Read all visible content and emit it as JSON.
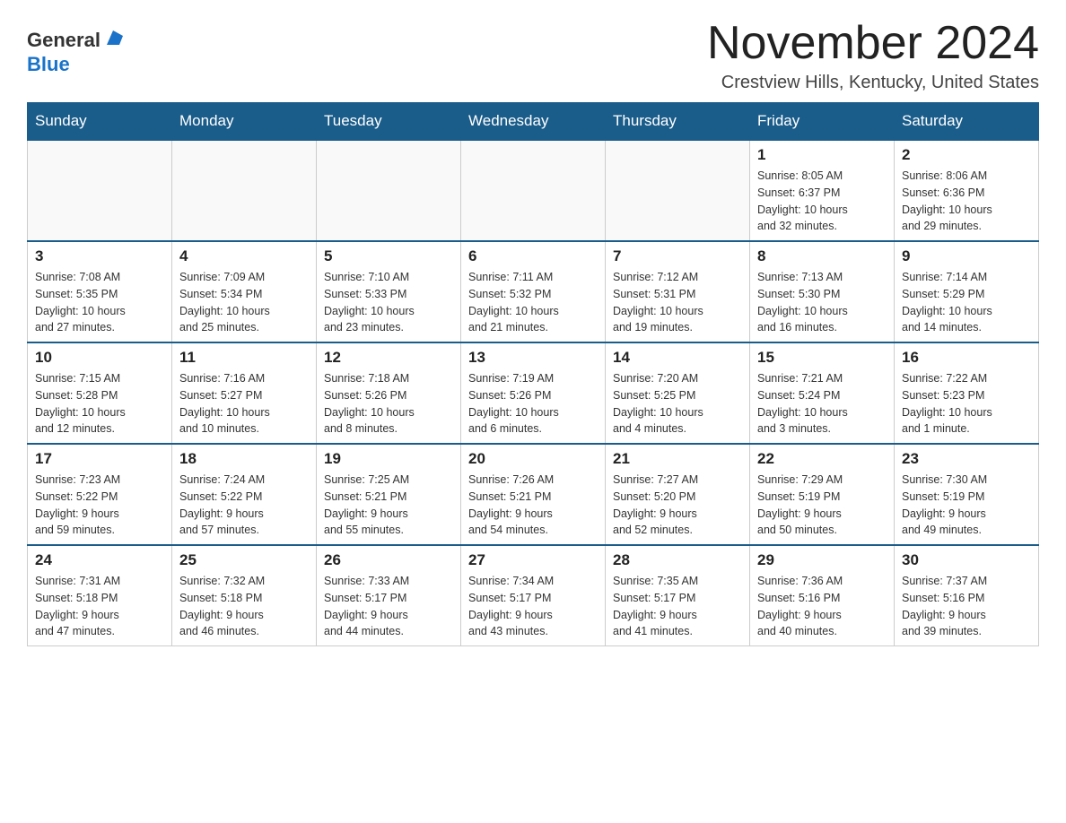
{
  "header": {
    "logo_general": "General",
    "logo_blue": "Blue",
    "month": "November 2024",
    "location": "Crestview Hills, Kentucky, United States"
  },
  "days_of_week": [
    "Sunday",
    "Monday",
    "Tuesday",
    "Wednesday",
    "Thursday",
    "Friday",
    "Saturday"
  ],
  "weeks": [
    [
      {
        "day": "",
        "info": ""
      },
      {
        "day": "",
        "info": ""
      },
      {
        "day": "",
        "info": ""
      },
      {
        "day": "",
        "info": ""
      },
      {
        "day": "",
        "info": ""
      },
      {
        "day": "1",
        "info": "Sunrise: 8:05 AM\nSunset: 6:37 PM\nDaylight: 10 hours\nand 32 minutes."
      },
      {
        "day": "2",
        "info": "Sunrise: 8:06 AM\nSunset: 6:36 PM\nDaylight: 10 hours\nand 29 minutes."
      }
    ],
    [
      {
        "day": "3",
        "info": "Sunrise: 7:08 AM\nSunset: 5:35 PM\nDaylight: 10 hours\nand 27 minutes."
      },
      {
        "day": "4",
        "info": "Sunrise: 7:09 AM\nSunset: 5:34 PM\nDaylight: 10 hours\nand 25 minutes."
      },
      {
        "day": "5",
        "info": "Sunrise: 7:10 AM\nSunset: 5:33 PM\nDaylight: 10 hours\nand 23 minutes."
      },
      {
        "day": "6",
        "info": "Sunrise: 7:11 AM\nSunset: 5:32 PM\nDaylight: 10 hours\nand 21 minutes."
      },
      {
        "day": "7",
        "info": "Sunrise: 7:12 AM\nSunset: 5:31 PM\nDaylight: 10 hours\nand 19 minutes."
      },
      {
        "day": "8",
        "info": "Sunrise: 7:13 AM\nSunset: 5:30 PM\nDaylight: 10 hours\nand 16 minutes."
      },
      {
        "day": "9",
        "info": "Sunrise: 7:14 AM\nSunset: 5:29 PM\nDaylight: 10 hours\nand 14 minutes."
      }
    ],
    [
      {
        "day": "10",
        "info": "Sunrise: 7:15 AM\nSunset: 5:28 PM\nDaylight: 10 hours\nand 12 minutes."
      },
      {
        "day": "11",
        "info": "Sunrise: 7:16 AM\nSunset: 5:27 PM\nDaylight: 10 hours\nand 10 minutes."
      },
      {
        "day": "12",
        "info": "Sunrise: 7:18 AM\nSunset: 5:26 PM\nDaylight: 10 hours\nand 8 minutes."
      },
      {
        "day": "13",
        "info": "Sunrise: 7:19 AM\nSunset: 5:26 PM\nDaylight: 10 hours\nand 6 minutes."
      },
      {
        "day": "14",
        "info": "Sunrise: 7:20 AM\nSunset: 5:25 PM\nDaylight: 10 hours\nand 4 minutes."
      },
      {
        "day": "15",
        "info": "Sunrise: 7:21 AM\nSunset: 5:24 PM\nDaylight: 10 hours\nand 3 minutes."
      },
      {
        "day": "16",
        "info": "Sunrise: 7:22 AM\nSunset: 5:23 PM\nDaylight: 10 hours\nand 1 minute."
      }
    ],
    [
      {
        "day": "17",
        "info": "Sunrise: 7:23 AM\nSunset: 5:22 PM\nDaylight: 9 hours\nand 59 minutes."
      },
      {
        "day": "18",
        "info": "Sunrise: 7:24 AM\nSunset: 5:22 PM\nDaylight: 9 hours\nand 57 minutes."
      },
      {
        "day": "19",
        "info": "Sunrise: 7:25 AM\nSunset: 5:21 PM\nDaylight: 9 hours\nand 55 minutes."
      },
      {
        "day": "20",
        "info": "Sunrise: 7:26 AM\nSunset: 5:21 PM\nDaylight: 9 hours\nand 54 minutes."
      },
      {
        "day": "21",
        "info": "Sunrise: 7:27 AM\nSunset: 5:20 PM\nDaylight: 9 hours\nand 52 minutes."
      },
      {
        "day": "22",
        "info": "Sunrise: 7:29 AM\nSunset: 5:19 PM\nDaylight: 9 hours\nand 50 minutes."
      },
      {
        "day": "23",
        "info": "Sunrise: 7:30 AM\nSunset: 5:19 PM\nDaylight: 9 hours\nand 49 minutes."
      }
    ],
    [
      {
        "day": "24",
        "info": "Sunrise: 7:31 AM\nSunset: 5:18 PM\nDaylight: 9 hours\nand 47 minutes."
      },
      {
        "day": "25",
        "info": "Sunrise: 7:32 AM\nSunset: 5:18 PM\nDaylight: 9 hours\nand 46 minutes."
      },
      {
        "day": "26",
        "info": "Sunrise: 7:33 AM\nSunset: 5:17 PM\nDaylight: 9 hours\nand 44 minutes."
      },
      {
        "day": "27",
        "info": "Sunrise: 7:34 AM\nSunset: 5:17 PM\nDaylight: 9 hours\nand 43 minutes."
      },
      {
        "day": "28",
        "info": "Sunrise: 7:35 AM\nSunset: 5:17 PM\nDaylight: 9 hours\nand 41 minutes."
      },
      {
        "day": "29",
        "info": "Sunrise: 7:36 AM\nSunset: 5:16 PM\nDaylight: 9 hours\nand 40 minutes."
      },
      {
        "day": "30",
        "info": "Sunrise: 7:37 AM\nSunset: 5:16 PM\nDaylight: 9 hours\nand 39 minutes."
      }
    ]
  ]
}
